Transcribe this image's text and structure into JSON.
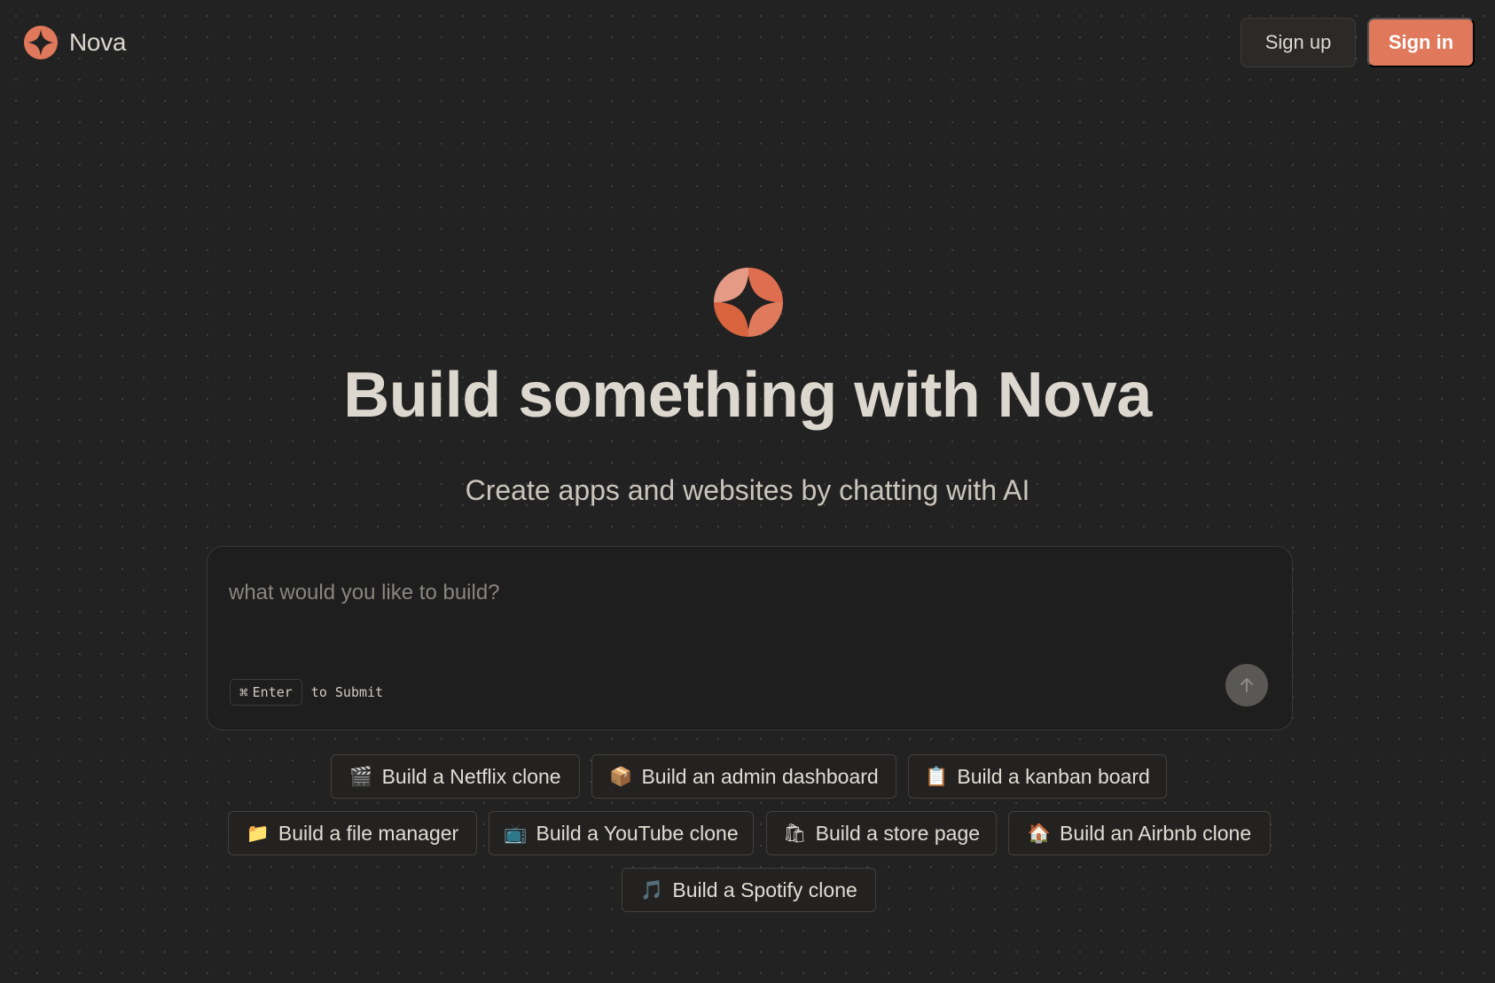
{
  "brand": {
    "name": "Nova",
    "logo_icon": "nova-star-logo-icon",
    "accent_color": "#e0785b"
  },
  "header": {
    "signup_label": "Sign up",
    "signin_label": "Sign in"
  },
  "hero": {
    "title": "Build something with Nova",
    "subtitle": "Create apps and websites by chatting with AI"
  },
  "prompt": {
    "placeholder": "what would you like to build?",
    "value": "",
    "shortcut_key_icon": "⌘",
    "shortcut_key": "Enter",
    "shortcut_hint": "to Submit",
    "send_icon": "arrow-up-icon"
  },
  "suggestions": [
    {
      "emoji": "🎬",
      "icon": "clapperboard-icon",
      "label": "Build a Netflix clone"
    },
    {
      "emoji": "📦",
      "icon": "package-icon",
      "label": "Build an admin dashboard"
    },
    {
      "emoji": "📋",
      "icon": "clipboard-icon",
      "label": "Build a kanban board"
    },
    {
      "emoji": "📁",
      "icon": "folder-icon",
      "label": "Build a file manager"
    },
    {
      "emoji": "📺",
      "icon": "television-icon",
      "label": "Build a YouTube clone"
    },
    {
      "emoji": "🛍",
      "icon": "shopping-bags-icon",
      "label": "Build a store page"
    },
    {
      "emoji": "🏠",
      "icon": "house-icon",
      "label": "Build an Airbnb clone"
    },
    {
      "emoji": "🎵",
      "icon": "music-note-icon",
      "label": "Build a Spotify clone"
    }
  ]
}
